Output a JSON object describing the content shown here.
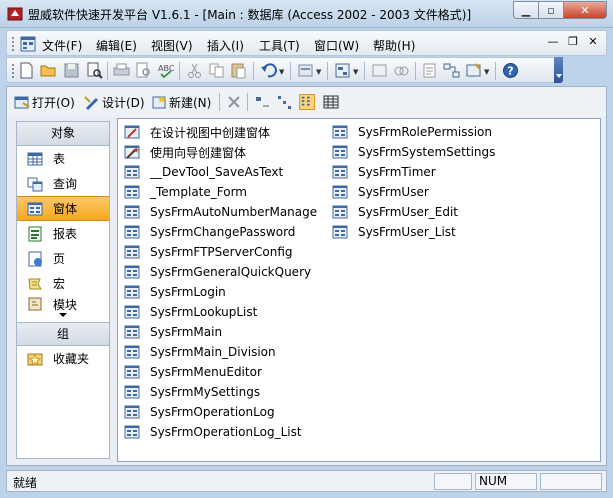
{
  "window": {
    "title": "盟威软件快速开发平台 V1.6.1 - [Main : 数据库 (Access 2002 - 2003 文件格式)]"
  },
  "menubar": {
    "items": [
      "文件(F)",
      "编辑(E)",
      "视图(V)",
      "插入(I)",
      "工具(T)",
      "窗口(W)",
      "帮助(H)"
    ]
  },
  "db_toolbar": {
    "open_label": "打开(O)",
    "design_label": "设计(D)",
    "new_label": "新建(N)"
  },
  "objects": {
    "header": "对象",
    "items": [
      {
        "label": "表",
        "icon": "table-icon"
      },
      {
        "label": "查询",
        "icon": "query-icon"
      },
      {
        "label": "窗体",
        "icon": "form-icon",
        "selected": true
      },
      {
        "label": "报表",
        "icon": "report-icon"
      },
      {
        "label": "页",
        "icon": "page-icon"
      },
      {
        "label": "宏",
        "icon": "macro-icon"
      },
      {
        "label": "模块",
        "icon": "module-icon"
      }
    ],
    "groups_header": "组",
    "groups": [
      {
        "label": "收藏夹",
        "icon": "favorites-icon"
      }
    ]
  },
  "list": {
    "column1": [
      {
        "label": "在设计视图中创建窗体",
        "icon": "design-wizard-icon"
      },
      {
        "label": "使用向导创建窗体",
        "icon": "wizard-icon"
      },
      {
        "label": "__DevTool_SaveAsText",
        "icon": "form-icon"
      },
      {
        "label": "_Template_Form",
        "icon": "form-icon"
      },
      {
        "label": "SysFrmAutoNumberManage",
        "icon": "form-icon"
      },
      {
        "label": "SysFrmChangePassword",
        "icon": "form-icon"
      },
      {
        "label": "SysFrmFTPServerConfig",
        "icon": "form-icon"
      },
      {
        "label": "SysFrmGeneralQuickQuery",
        "icon": "form-icon"
      },
      {
        "label": "SysFrmLogin",
        "icon": "form-icon"
      },
      {
        "label": "SysFrmLookupList",
        "icon": "form-icon"
      },
      {
        "label": "SysFrmMain",
        "icon": "form-icon"
      },
      {
        "label": "SysFrmMain_Division",
        "icon": "form-icon"
      },
      {
        "label": "SysFrmMenuEditor",
        "icon": "form-icon"
      },
      {
        "label": "SysFrmMySettings",
        "icon": "form-icon"
      },
      {
        "label": "SysFrmOperationLog",
        "icon": "form-icon"
      },
      {
        "label": "SysFrmOperationLog_List",
        "icon": "form-icon"
      }
    ],
    "column2": [
      {
        "label": "SysFrmRolePermission",
        "icon": "form-icon"
      },
      {
        "label": "SysFrmSystemSettings",
        "icon": "form-icon"
      },
      {
        "label": "SysFrmTimer",
        "icon": "form-icon"
      },
      {
        "label": "SysFrmUser",
        "icon": "form-icon"
      },
      {
        "label": "SysFrmUser_Edit",
        "icon": "form-icon"
      },
      {
        "label": "SysFrmUser_List",
        "icon": "form-icon"
      }
    ]
  },
  "statusbar": {
    "text": "就绪",
    "num_indicator": "NUM"
  }
}
